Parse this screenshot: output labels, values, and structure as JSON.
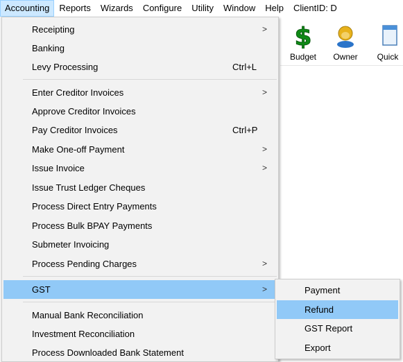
{
  "menubar": {
    "items": [
      "Accounting",
      "Reports",
      "Wizards",
      "Configure",
      "Utility",
      "Window",
      "Help"
    ],
    "client_id": "ClientID: D"
  },
  "toolbar": {
    "buttons": [
      {
        "label": "Budget",
        "icon": "dollar-icon"
      },
      {
        "label": "Owner",
        "icon": "owner-icon"
      },
      {
        "label": "Quick",
        "icon": "quick-icon"
      }
    ]
  },
  "accounting_menu": {
    "items": [
      {
        "label": "Receipting",
        "shortcut": "",
        "submenu": true
      },
      {
        "label": "Banking",
        "shortcut": "",
        "submenu": false
      },
      {
        "label": "Levy Processing",
        "shortcut": "Ctrl+L",
        "submenu": false
      },
      {
        "label": "Enter Creditor Invoices",
        "shortcut": "",
        "submenu": true
      },
      {
        "label": "Approve Creditor Invoices",
        "shortcut": "",
        "submenu": false
      },
      {
        "label": "Pay Creditor Invoices",
        "shortcut": "Ctrl+P",
        "submenu": false
      },
      {
        "label": "Make One-off Payment",
        "shortcut": "",
        "submenu": true
      },
      {
        "label": "Issue Invoice",
        "shortcut": "",
        "submenu": true
      },
      {
        "label": "Issue Trust Ledger Cheques",
        "shortcut": "",
        "submenu": false
      },
      {
        "label": "Process Direct Entry Payments",
        "shortcut": "",
        "submenu": false
      },
      {
        "label": "Process Bulk BPAY Payments",
        "shortcut": "",
        "submenu": false
      },
      {
        "label": "Submeter Invoicing",
        "shortcut": "",
        "submenu": false
      },
      {
        "label": "Process Pending Charges",
        "shortcut": "",
        "submenu": true
      },
      {
        "label": "GST",
        "shortcut": "",
        "submenu": true
      },
      {
        "label": "Manual Bank Reconciliation",
        "shortcut": "",
        "submenu": false
      },
      {
        "label": "Investment Reconciliation",
        "shortcut": "",
        "submenu": false
      },
      {
        "label": "Process Downloaded Bank Statement",
        "shortcut": "",
        "submenu": false
      }
    ],
    "arrow_glyph": ">"
  },
  "gst_submenu": {
    "items": [
      "Payment",
      "Refund",
      "GST Report",
      "Export"
    ]
  },
  "colors": {
    "menu_bg": "#f2f2f2",
    "highlight": "#91c9f7",
    "menubar_active": "#cce8ff"
  }
}
